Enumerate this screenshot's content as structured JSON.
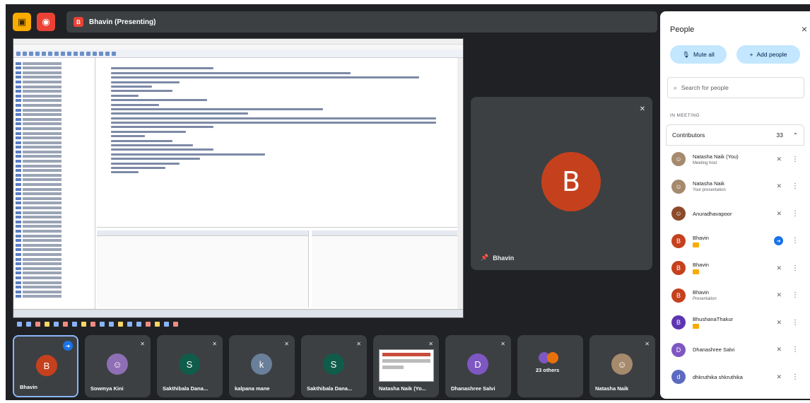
{
  "topbar": {
    "presenting_initial": "B",
    "presenting_label": "Bhavin (Presenting)"
  },
  "speaker": {
    "initial": "B",
    "name": "Bhavin"
  },
  "strip": [
    {
      "name": "Bhavin",
      "initial": "B",
      "color": "#c5411d",
      "active": true
    },
    {
      "name": "Sowmya Kini",
      "initial": "",
      "color": "#8e6fb5"
    },
    {
      "name": "Sakthibala Dana...",
      "initial": "S",
      "color": "#0f5c4b"
    },
    {
      "name": "kalpana mane",
      "initial": "k",
      "color": "#6a7f99"
    },
    {
      "name": "Sakthibala Dana...",
      "initial": "S",
      "color": "#0f5c4b"
    },
    {
      "name": "Natasha Naik (Yo...",
      "initial": "",
      "color": ""
    },
    {
      "name": "Dhanashree Salvi",
      "initial": "D",
      "color": "#7e57c2"
    },
    {
      "name": "23 others",
      "initial": "",
      "color": ""
    },
    {
      "name": "Natasha Naik",
      "initial": "",
      "color": "#a68a6d"
    }
  ],
  "panel": {
    "title": "People",
    "close_icon": "×",
    "mute_all": "Mute all",
    "add_people": "Add people",
    "search_placeholder": "Search for people",
    "section": "IN MEETING",
    "group": "Contributors",
    "group_count": "33",
    "people": [
      {
        "name": "Natasha Naik (You)",
        "sub": "Meeting host",
        "initial": "",
        "color": "#a68a6d"
      },
      {
        "name": "Natasha Naik",
        "sub": "Your presentation",
        "initial": "",
        "color": "#a68a6d"
      },
      {
        "name": "Anuradhavapoor",
        "sub": "",
        "initial": "",
        "color": "#8d4a2b"
      },
      {
        "name": "Bhavin",
        "sub": "",
        "initial": "B",
        "color": "#c5411d"
      },
      {
        "name": "Bhavin",
        "sub": "",
        "initial": "B",
        "color": "#c5411d"
      },
      {
        "name": "Bhavin",
        "sub": "Presentation",
        "initial": "B",
        "color": "#c5411d"
      },
      {
        "name": "BhushanaThakur",
        "sub": "",
        "initial": "B",
        "color": "#5e35b1"
      },
      {
        "name": "Dhanashree Salvi",
        "sub": "",
        "initial": "D",
        "color": "#7e57c2"
      },
      {
        "name": "dhkruthika shkruthika",
        "sub": "",
        "initial": "d",
        "color": "#5c6bc0"
      }
    ]
  }
}
